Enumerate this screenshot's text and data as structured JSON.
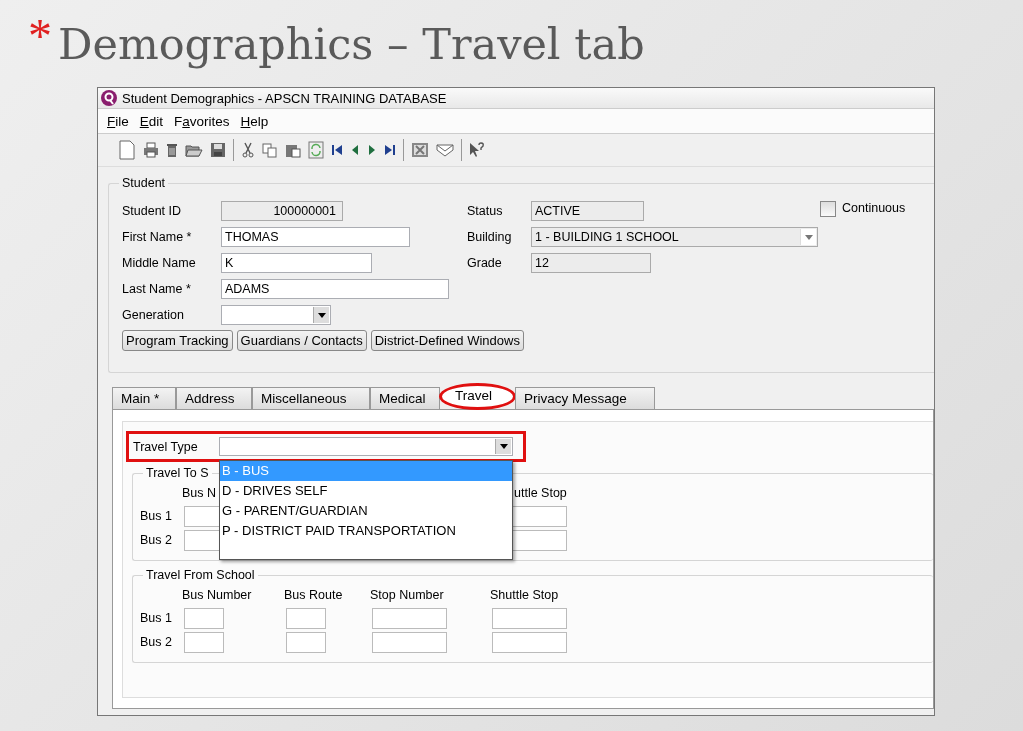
{
  "slide": {
    "marker": "*",
    "title": "Demographics – Travel tab"
  },
  "window": {
    "title": "Student Demographics - APSCN TRAINING DATABASE"
  },
  "menu": [
    {
      "key": "F",
      "post": "ile"
    },
    {
      "key": "E",
      "post": "dit"
    },
    {
      "pre": "F",
      "key": "a",
      "post": "vorites"
    },
    {
      "key": "H",
      "post": "elp"
    }
  ],
  "student": {
    "legend": "Student",
    "left_fields": [
      {
        "label": "Student ID",
        "value": "100000001",
        "kind": "readonly"
      },
      {
        "label": "First Name *",
        "value": "THOMAS",
        "kind": "text"
      },
      {
        "label": "Middle Name",
        "value": "K",
        "kind": "text"
      },
      {
        "label": "Last Name *",
        "value": "ADAMS",
        "kind": "text"
      },
      {
        "label": "Generation",
        "kind": "combo"
      }
    ],
    "right_fields": [
      {
        "label": "Status",
        "value": "ACTIVE",
        "kind": "readonly"
      },
      {
        "label": "Building",
        "value": "1 - BUILDING 1 SCHOOL",
        "kind": "combo"
      },
      {
        "label": "Grade",
        "value": "12",
        "kind": "readonly"
      }
    ],
    "continuous": {
      "label": "Continuous",
      "checked": false
    },
    "buttons": [
      "Program Tracking",
      "Guardians / Contacts",
      "District-Defined Windows"
    ]
  },
  "tabs": [
    {
      "label": "Main *",
      "selected": false,
      "circled": false
    },
    {
      "label": "Address",
      "selected": false,
      "circled": false
    },
    {
      "label": "Miscellaneous",
      "selected": false,
      "circled": false
    },
    {
      "label": "Medical",
      "selected": false,
      "circled": false
    },
    {
      "label": "Travel",
      "selected": true,
      "circled": true
    },
    {
      "label": "Privacy Message",
      "selected": false,
      "circled": false
    }
  ],
  "travel_type": {
    "label": "Travel Type",
    "boxed": true,
    "open": true,
    "options": [
      {
        "label": "B - BUS",
        "selected": true
      },
      {
        "label": "D - DRIVES SELF",
        "selected": false
      },
      {
        "label": "G - PARENT/GUARDIAN",
        "selected": false
      },
      {
        "label": "P - DISTRICT PAID TRANSPORTATION",
        "selected": false
      }
    ]
  },
  "travel_to_school": {
    "legend": "Travel To S",
    "columns": [
      "Bus N",
      "uttle Stop"
    ],
    "rows": [
      "Bus 1",
      "Bus 2"
    ]
  },
  "travel_from_school": {
    "legend": "Travel From School",
    "columns": [
      "Bus Number",
      "Bus Route",
      "Stop Number",
      "Shuttle Stop"
    ],
    "rows": [
      "Bus 1",
      "Bus 2"
    ]
  }
}
